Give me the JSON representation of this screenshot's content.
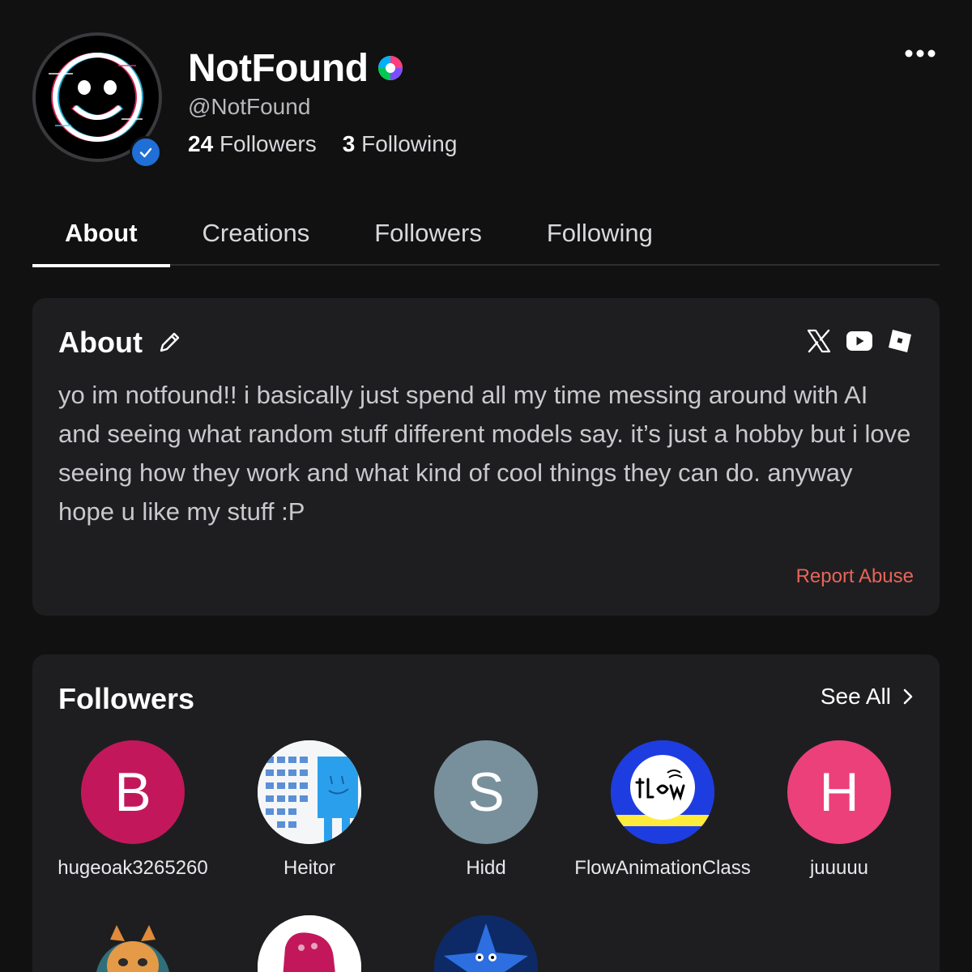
{
  "profile": {
    "display_name": "NotFound",
    "username": "@NotFound",
    "followers_count": "24",
    "followers_label": "Followers",
    "following_count": "3",
    "following_label": "Following",
    "avatar_icon": "glitch-smiley-icon",
    "verified_icon": "check-icon",
    "premium_icon": "rainbow-swirl-icon"
  },
  "tabs": [
    {
      "label": "About",
      "active": true
    },
    {
      "label": "Creations",
      "active": false
    },
    {
      "label": "Followers",
      "active": false
    },
    {
      "label": "Following",
      "active": false
    }
  ],
  "about": {
    "title": "About",
    "bio": "yo im notfound!! i basically just spend all my time messing around with AI and seeing what random stuff different models say. it’s just a hobby but i love seeing how they work and what kind of cool things they can do. anyway hope u like my stuff :P",
    "social_icons": [
      "x-icon",
      "youtube-icon",
      "roblox-icon"
    ],
    "report_label": "Report Abuse",
    "report_color": "#e8645a"
  },
  "followers_section": {
    "title": "Followers",
    "see_all_label": "See All",
    "items": [
      {
        "name": "hugeoak3265260",
        "initial": "B",
        "color": "#c2185b"
      },
      {
        "name": "Heitor",
        "initial": "",
        "color": "#ffffff"
      },
      {
        "name": "Hidd",
        "initial": "S",
        "color": "#78909c"
      },
      {
        "name": "FlowAnimationClass",
        "initial": "",
        "color": "#1e3de0"
      },
      {
        "name": "juuuuu",
        "initial": "H",
        "color": "#ec407a"
      }
    ]
  },
  "colors": {
    "background": "#111112",
    "card": "#1e1e20",
    "accent_blue": "#1f6fd6"
  }
}
